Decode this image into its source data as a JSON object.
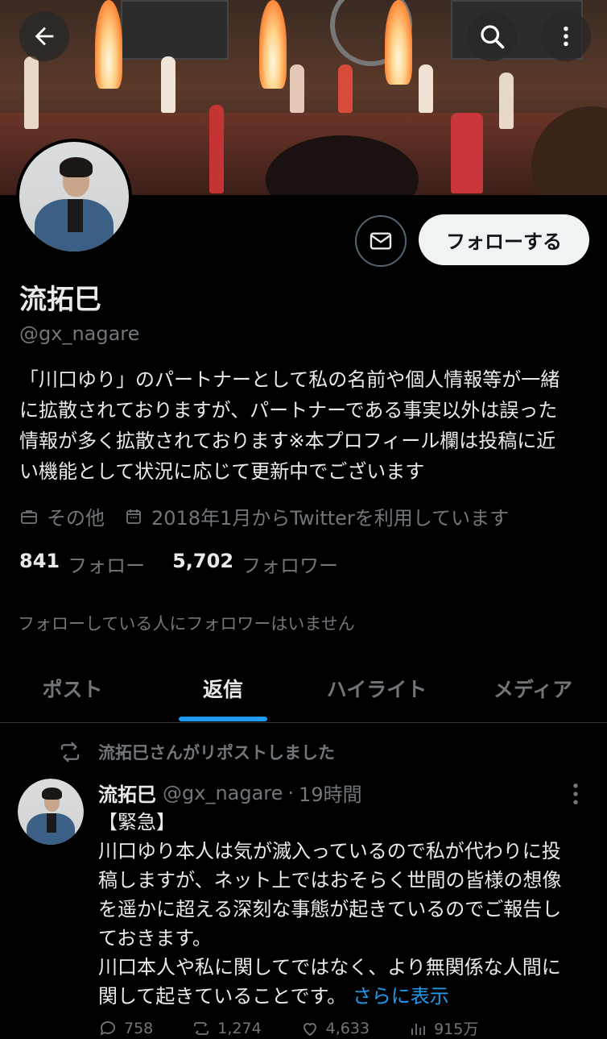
{
  "header": {
    "back_icon": "arrow-left-icon",
    "search_icon": "search-icon",
    "more_icon": "more-vertical-icon"
  },
  "profile": {
    "name": "流拓巳",
    "handle": "@gx_nagare",
    "follow_label": "フォローする",
    "message_icon": "envelope-icon",
    "bio_lines": [
      "「川口ゆり」のパートナーとして私の名前や個人情報等が一緒",
      "に拡散されておりますが、パートナーである事実以外は誤った",
      "情報が多く拡散されております※本プロフィール欄は投稿に近",
      "い機能として状況に応じて更新中でございます"
    ],
    "category": "その他",
    "joined": "2018年1月からTwitterを利用しています",
    "following_count": "841",
    "following_label": "フォロー",
    "followers_count": "5,702",
    "followers_label": "フォロワー",
    "no_common_followers": "フォローしている人にフォロワーはいません"
  },
  "tabs": [
    {
      "label": "ポスト",
      "active": false
    },
    {
      "label": "返信",
      "active": true
    },
    {
      "label": "ハイライト",
      "active": false
    },
    {
      "label": "メディア",
      "active": false
    }
  ],
  "post": {
    "repost_text": "流拓巳さんがリポストしました",
    "author_name": "流拓巳",
    "author_handle": "@gx_nagare",
    "time": "19時間",
    "body_lines": [
      "【緊急】",
      "川口ゆり本人は気が滅入っているので私が代わりに投",
      "稿しますが、ネット上ではおそらく世間の皆様の想像",
      "を遥かに超える深刻な事態が起きているのでご報告し",
      "ておきます。",
      "川口本人や私に関してではなく、より無関係な人間に",
      "関して起きていることです。"
    ],
    "show_more": "さらに表示",
    "replies": "758",
    "reposts": "1,274",
    "likes": "4,633",
    "views": "915万"
  },
  "colors": {
    "background": "#000000",
    "text": "#e7e9ea",
    "muted": "#71767b",
    "accent": "#1d9bf0"
  }
}
